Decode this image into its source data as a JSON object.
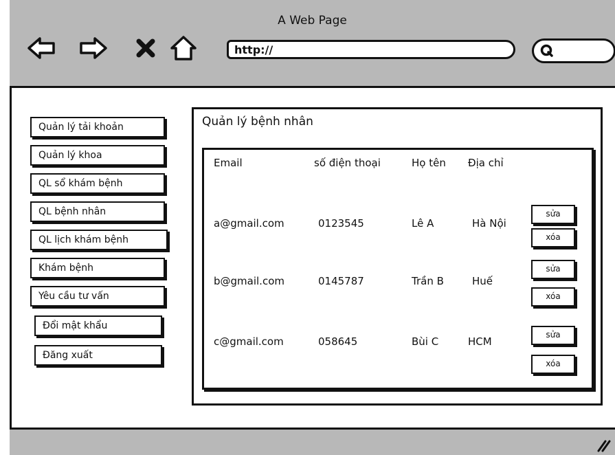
{
  "window": {
    "title": "A Web Page"
  },
  "browser": {
    "url": "http://",
    "icons": [
      "back-arrow-icon",
      "forward-arrow-icon",
      "close-x-icon",
      "home-icon",
      "search-icon"
    ]
  },
  "sidebar": {
    "items": [
      {
        "label": "Quản lý tải khoản"
      },
      {
        "label": "Quản lý khoa"
      },
      {
        "label": "QL sổ khám bệnh"
      },
      {
        "label": "QL bệnh nhân"
      },
      {
        "label": "QL lịch khám bệnh"
      },
      {
        "label": "Khám bệnh"
      },
      {
        "label": "Yêu cầu tư vấn"
      },
      {
        "label": "Đổi mật khẩu"
      },
      {
        "label": "Đăng xuất"
      }
    ]
  },
  "main": {
    "heading": "Quản lý bệnh nhân",
    "table": {
      "headers": [
        "Email",
        "số điện thoại",
        "Họ tên",
        "Địa chỉ"
      ],
      "rows": [
        {
          "email": "a@gmail.com",
          "phone": "0123545",
          "name": "Lê A",
          "address": "Hà Nội",
          "edit": "sửa",
          "delete": "xóa"
        },
        {
          "email": "b@gmail.com",
          "phone": "0145787",
          "name": "Trần B",
          "address": "Huế",
          "edit": "sửa",
          "delete": "xóa"
        },
        {
          "email": "c@gmail.com",
          "phone": "058645",
          "name": "Bùi C",
          "address": "HCM",
          "edit": "sửa",
          "delete": "xóa"
        }
      ]
    }
  }
}
